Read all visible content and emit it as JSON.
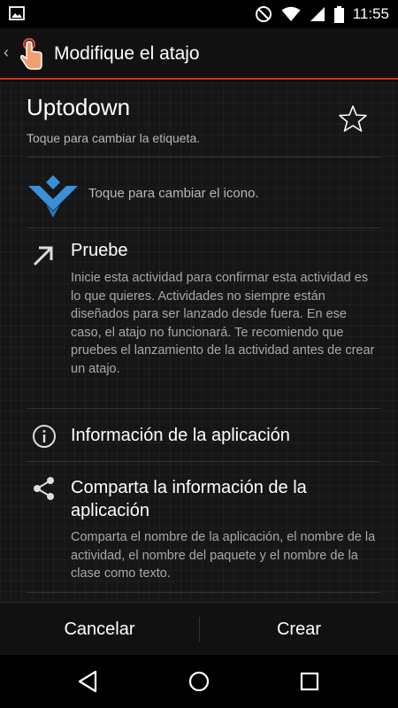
{
  "status": {
    "time": "11:55"
  },
  "appbar": {
    "title": "Modifique el atajo"
  },
  "label": {
    "title": "Uptodown",
    "hint": "Toque para cambiar la etiqueta."
  },
  "icon_row": {
    "hint": "Toque para cambiar el icono."
  },
  "test": {
    "title": "Pruebe",
    "description": "Inicie esta actividad para confirmar esta actividad es lo que quieres. Actividades no siempre están diseñados para ser lanzado desde fuera. En ese caso, el atajo no funcionará. Te recomiendo que pruebes el lanzamiento de la actividad antes de crear un atajo."
  },
  "app_info": {
    "title": "Información de la aplicación"
  },
  "share": {
    "title": "Comparta la información de la aplicación",
    "description": "Comparta el nombre de la aplicación, el nombre de la actividad, el nombre del paquete y el nombre de la clase como texto."
  },
  "buttons": {
    "cancel": "Cancelar",
    "create": "Crear"
  },
  "colors": {
    "accent": "#c0392b",
    "logo": "#3a8fd6"
  },
  "icons": [
    "image-icon",
    "dnd-icon",
    "wifi-icon",
    "signal-icon",
    "battery-icon",
    "touch-shortcut-icon",
    "star-icon",
    "uptodown-logo-icon",
    "arrow-up-right-icon",
    "info-icon",
    "share-icon",
    "back-icon",
    "home-icon",
    "recents-icon"
  ]
}
